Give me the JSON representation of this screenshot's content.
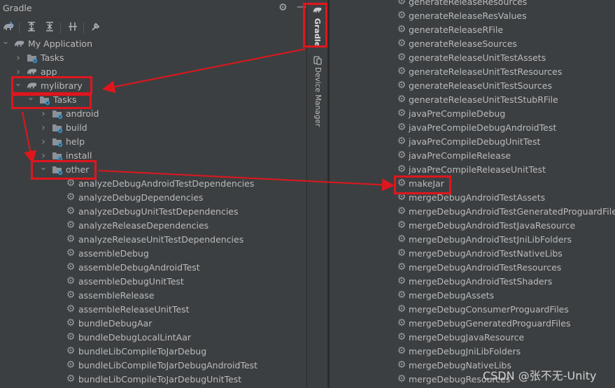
{
  "panel": {
    "title": "Gradle",
    "strip_gradle_label": "Gradle",
    "strip_device_label": "Device Manager"
  },
  "tree": {
    "root": "My Application",
    "root_tasks": "Tasks",
    "app": "app",
    "mylibrary": "mylibrary",
    "lib_tasks": "Tasks",
    "groups": [
      "android",
      "build",
      "help",
      "install",
      "other"
    ],
    "other_tasks": [
      "analyzeDebugAndroidTestDependencies",
      "analyzeDebugDependencies",
      "analyzeDebugUnitTestDependencies",
      "analyzeReleaseDependencies",
      "analyzeReleaseUnitTestDependencies",
      "assembleDebug",
      "assembleDebugAndroidTest",
      "assembleDebugUnitTest",
      "assembleRelease",
      "assembleReleaseUnitTest",
      "bundleDebugAar",
      "bundleDebugLocalLintAar",
      "bundleLibCompileToJarDebug",
      "bundleLibCompileToJarDebugAndroidTest",
      "bundleLibCompileToJarDebugUnitTest"
    ]
  },
  "right_tasks": [
    "generateReleaseResources",
    "generateReleaseResValues",
    "generateReleaseRFile",
    "generateReleaseSources",
    "generateReleaseUnitTestAssets",
    "generateReleaseUnitTestResources",
    "generateReleaseUnitTestSources",
    "generateReleaseUnitTestStubRFile",
    "javaPreCompileDebug",
    "javaPreCompileDebugAndroidTest",
    "javaPreCompileDebugUnitTest",
    "javaPreCompileRelease",
    "javaPreCompileReleaseUnitTest",
    "makeJar",
    "mergeDebugAndroidTestAssets",
    "mergeDebugAndroidTestGeneratedProguardFiles",
    "mergeDebugAndroidTestJavaResource",
    "mergeDebugAndroidTestJniLibFolders",
    "mergeDebugAndroidTestNativeLibs",
    "mergeDebugAndroidTestResources",
    "mergeDebugAndroidTestShaders",
    "mergeDebugAssets",
    "mergeDebugConsumerProguardFiles",
    "mergeDebugGeneratedProguardFiles",
    "mergeDebugJavaResource",
    "mergeDebugJniLibFolders",
    "mergeDebugNativeLibs",
    "mergeDebugResources"
  ],
  "watermark": "CSDN @张不无-Unity",
  "colors": {
    "background": "#3c3f41",
    "text": "#bbbbbb",
    "highlight": "#e0161d",
    "folder": "#8a9199",
    "gradle_elephant": "#9aa0a6",
    "task_badge": "#3592c4"
  },
  "icons": {
    "gear": "gear-icon",
    "elephant": "gradle-elephant-icon",
    "folder": "folder-icon",
    "chevron": "chevron-icon"
  }
}
